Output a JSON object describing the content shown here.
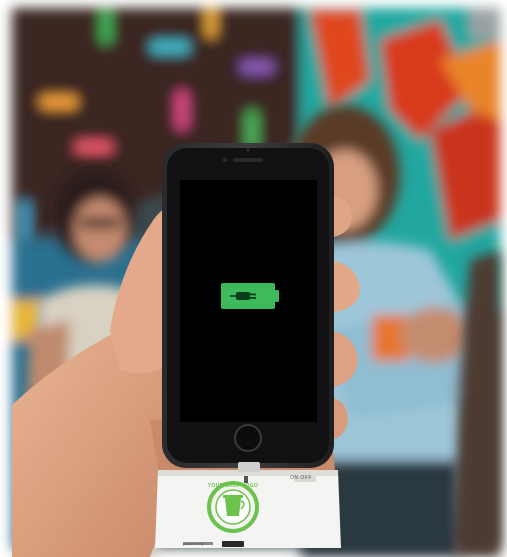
{
  "photo": {
    "subject": "hand holding smartphone with charger attachment",
    "screen_icon": "battery-charging-icon",
    "accent_color": "#3dbb5c"
  },
  "charger": {
    "switch_label": "ON OFF",
    "logo_text": "YOUR SHOP LOGO",
    "logo_color": "#6cc24a",
    "footer_text": "powered by"
  }
}
